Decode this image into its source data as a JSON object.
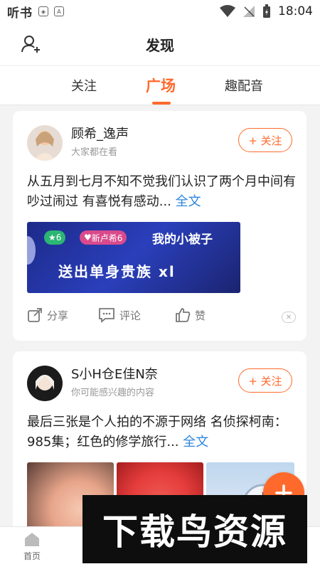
{
  "statusbar": {
    "app_logo": "听书",
    "time": "18:04"
  },
  "header": {
    "title": "发现"
  },
  "tabs": [
    {
      "label": "关注"
    },
    {
      "label": "广场"
    },
    {
      "label": "趣配音"
    }
  ],
  "active_tab": "广场",
  "feed": [
    {
      "username": "顾希_逸声",
      "subtitle": "大家都在看",
      "follow_label": "+ 关注",
      "text": "从五月到七月不知不觉我们认识了两个月中间有吵过闹过 有喜悦有感动...",
      "more_label": "全文",
      "media": {
        "badge1": "6",
        "badge2": "新卢希6",
        "line1": "我的小被子",
        "line2": "送出单身贵族 xl"
      },
      "actions": {
        "share": "分享",
        "comment": "评论",
        "like": "赞"
      }
    },
    {
      "username": "S小H仓E佳N奈",
      "subtitle": "你可能感兴趣的内容",
      "follow_label": "+ 关注",
      "text": "最后三张是个人拍的不源于网络 名侦探柯南：985集；红色的修学旅行...",
      "more_label": "全文"
    }
  ],
  "bottom_nav": [
    {
      "label": "首页"
    },
    {
      "label": ""
    },
    {
      "label": ""
    },
    {
      "label": ""
    },
    {
      "label": ""
    }
  ],
  "watermark": "下载鸟资源",
  "colors": {
    "accent": "#ff6a2c",
    "link": "#2e86de"
  }
}
